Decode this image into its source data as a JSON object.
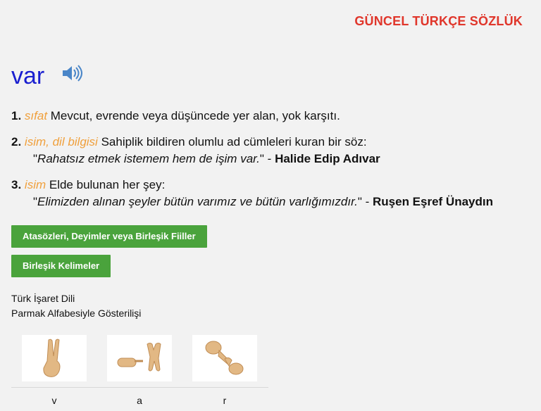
{
  "header": {
    "brand": "GÜNCEL TÜRKÇE SÖZLÜK"
  },
  "entry": {
    "word": "var",
    "audio_icon": "speaker-icon",
    "definitions": [
      {
        "number": "1.",
        "pos": "sıfat",
        "text": " Mevcut, evrende veya düşüncede yer alan, yok karşıtı."
      },
      {
        "number": "2.",
        "pos": "isim, dil bilgisi",
        "text": " Sahiplik bildiren olumlu ad cümleleri kuran bir söz:",
        "quote_open": "\"",
        "quote": "Rahatsız etmek istemem hem de işim var.",
        "quote_close": "\" - ",
        "author": "Halide Edip Adıvar"
      },
      {
        "number": "3.",
        "pos": "isim",
        "text": " Elde bulunan her şey:",
        "quote_open": "\"",
        "quote": "Elimizden alınan şeyler bütün varımız ve bütün varlığımızdır.",
        "quote_close": "\" - ",
        "author": "Ruşen Eşref Ünaydın"
      }
    ]
  },
  "buttons": {
    "idioms": "Atasözleri, Deyimler veya Birleşik Fiiller",
    "compounds": "Birleşik Kelimeler"
  },
  "sign_language": {
    "title": "Türk İşaret Dili",
    "subtitle": "Parmak Alfabesiyle Gösterilişi",
    "letters": [
      "v",
      "a",
      "r"
    ]
  },
  "colors": {
    "brand": "#e0362b",
    "word": "#1a1fd0",
    "pos": "#f0a03c",
    "button": "#4aa33c"
  }
}
